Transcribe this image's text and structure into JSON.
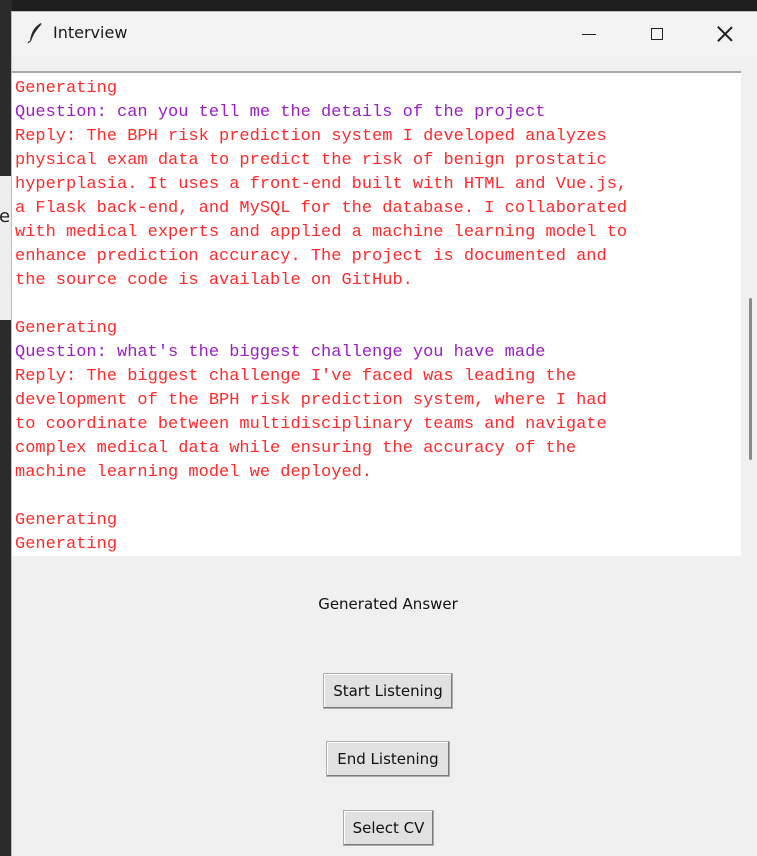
{
  "window": {
    "title": "Interview",
    "icon": "feather-icon"
  },
  "controls": {
    "minimize_icon": "minimize-icon",
    "maximize_icon": "maximize-icon",
    "close_icon": "close-icon"
  },
  "transcript": {
    "lines": [
      {
        "text": "Generating",
        "color": "#ff2a2a"
      },
      {
        "text": "Question: can you tell me the details of the project",
        "color": "#9a1fc3"
      },
      {
        "text": "Reply: The BPH risk prediction system I developed analyzes",
        "color": "#ff2a2a"
      },
      {
        "text": "physical exam data to predict the risk of benign prostatic",
        "color": "#ff2a2a"
      },
      {
        "text": "hyperplasia. It uses a front-end built with HTML and Vue.js,",
        "color": "#ff2a2a"
      },
      {
        "text": "a Flask back-end, and MySQL for the database. I collaborated",
        "color": "#ff2a2a"
      },
      {
        "text": "with medical experts and applied a machine learning model to",
        "color": "#ff2a2a"
      },
      {
        "text": "enhance prediction accuracy. The project is documented and",
        "color": "#ff2a2a"
      },
      {
        "text": "the source code is available on GitHub.",
        "color": "#ff2a2a"
      },
      {
        "text": "",
        "color": "#ff2a2a"
      },
      {
        "text": "Generating",
        "color": "#ff2a2a"
      },
      {
        "text": "Question: what's the biggest challenge you have made",
        "color": "#9a1fc3"
      },
      {
        "text": "Reply: The biggest challenge I've faced was leading the",
        "color": "#ff2a2a"
      },
      {
        "text": "development of the BPH risk prediction system, where I had",
        "color": "#ff2a2a"
      },
      {
        "text": "to coordinate between multidisciplinary teams and navigate",
        "color": "#ff2a2a"
      },
      {
        "text": "complex medical data while ensuring the accuracy of the",
        "color": "#ff2a2a"
      },
      {
        "text": "machine learning model we deployed.",
        "color": "#ff2a2a"
      },
      {
        "text": "",
        "color": "#ff2a2a"
      },
      {
        "text": "Generating",
        "color": "#ff2a2a"
      },
      {
        "text": "Generating",
        "color": "#ff2a2a"
      }
    ]
  },
  "status_label": "Generated Answer",
  "buttons": {
    "start_listening": "Start Listening",
    "end_listening": "End Listening",
    "select_cv": "Select CV"
  },
  "background": {
    "fragment_letter": "e"
  }
}
